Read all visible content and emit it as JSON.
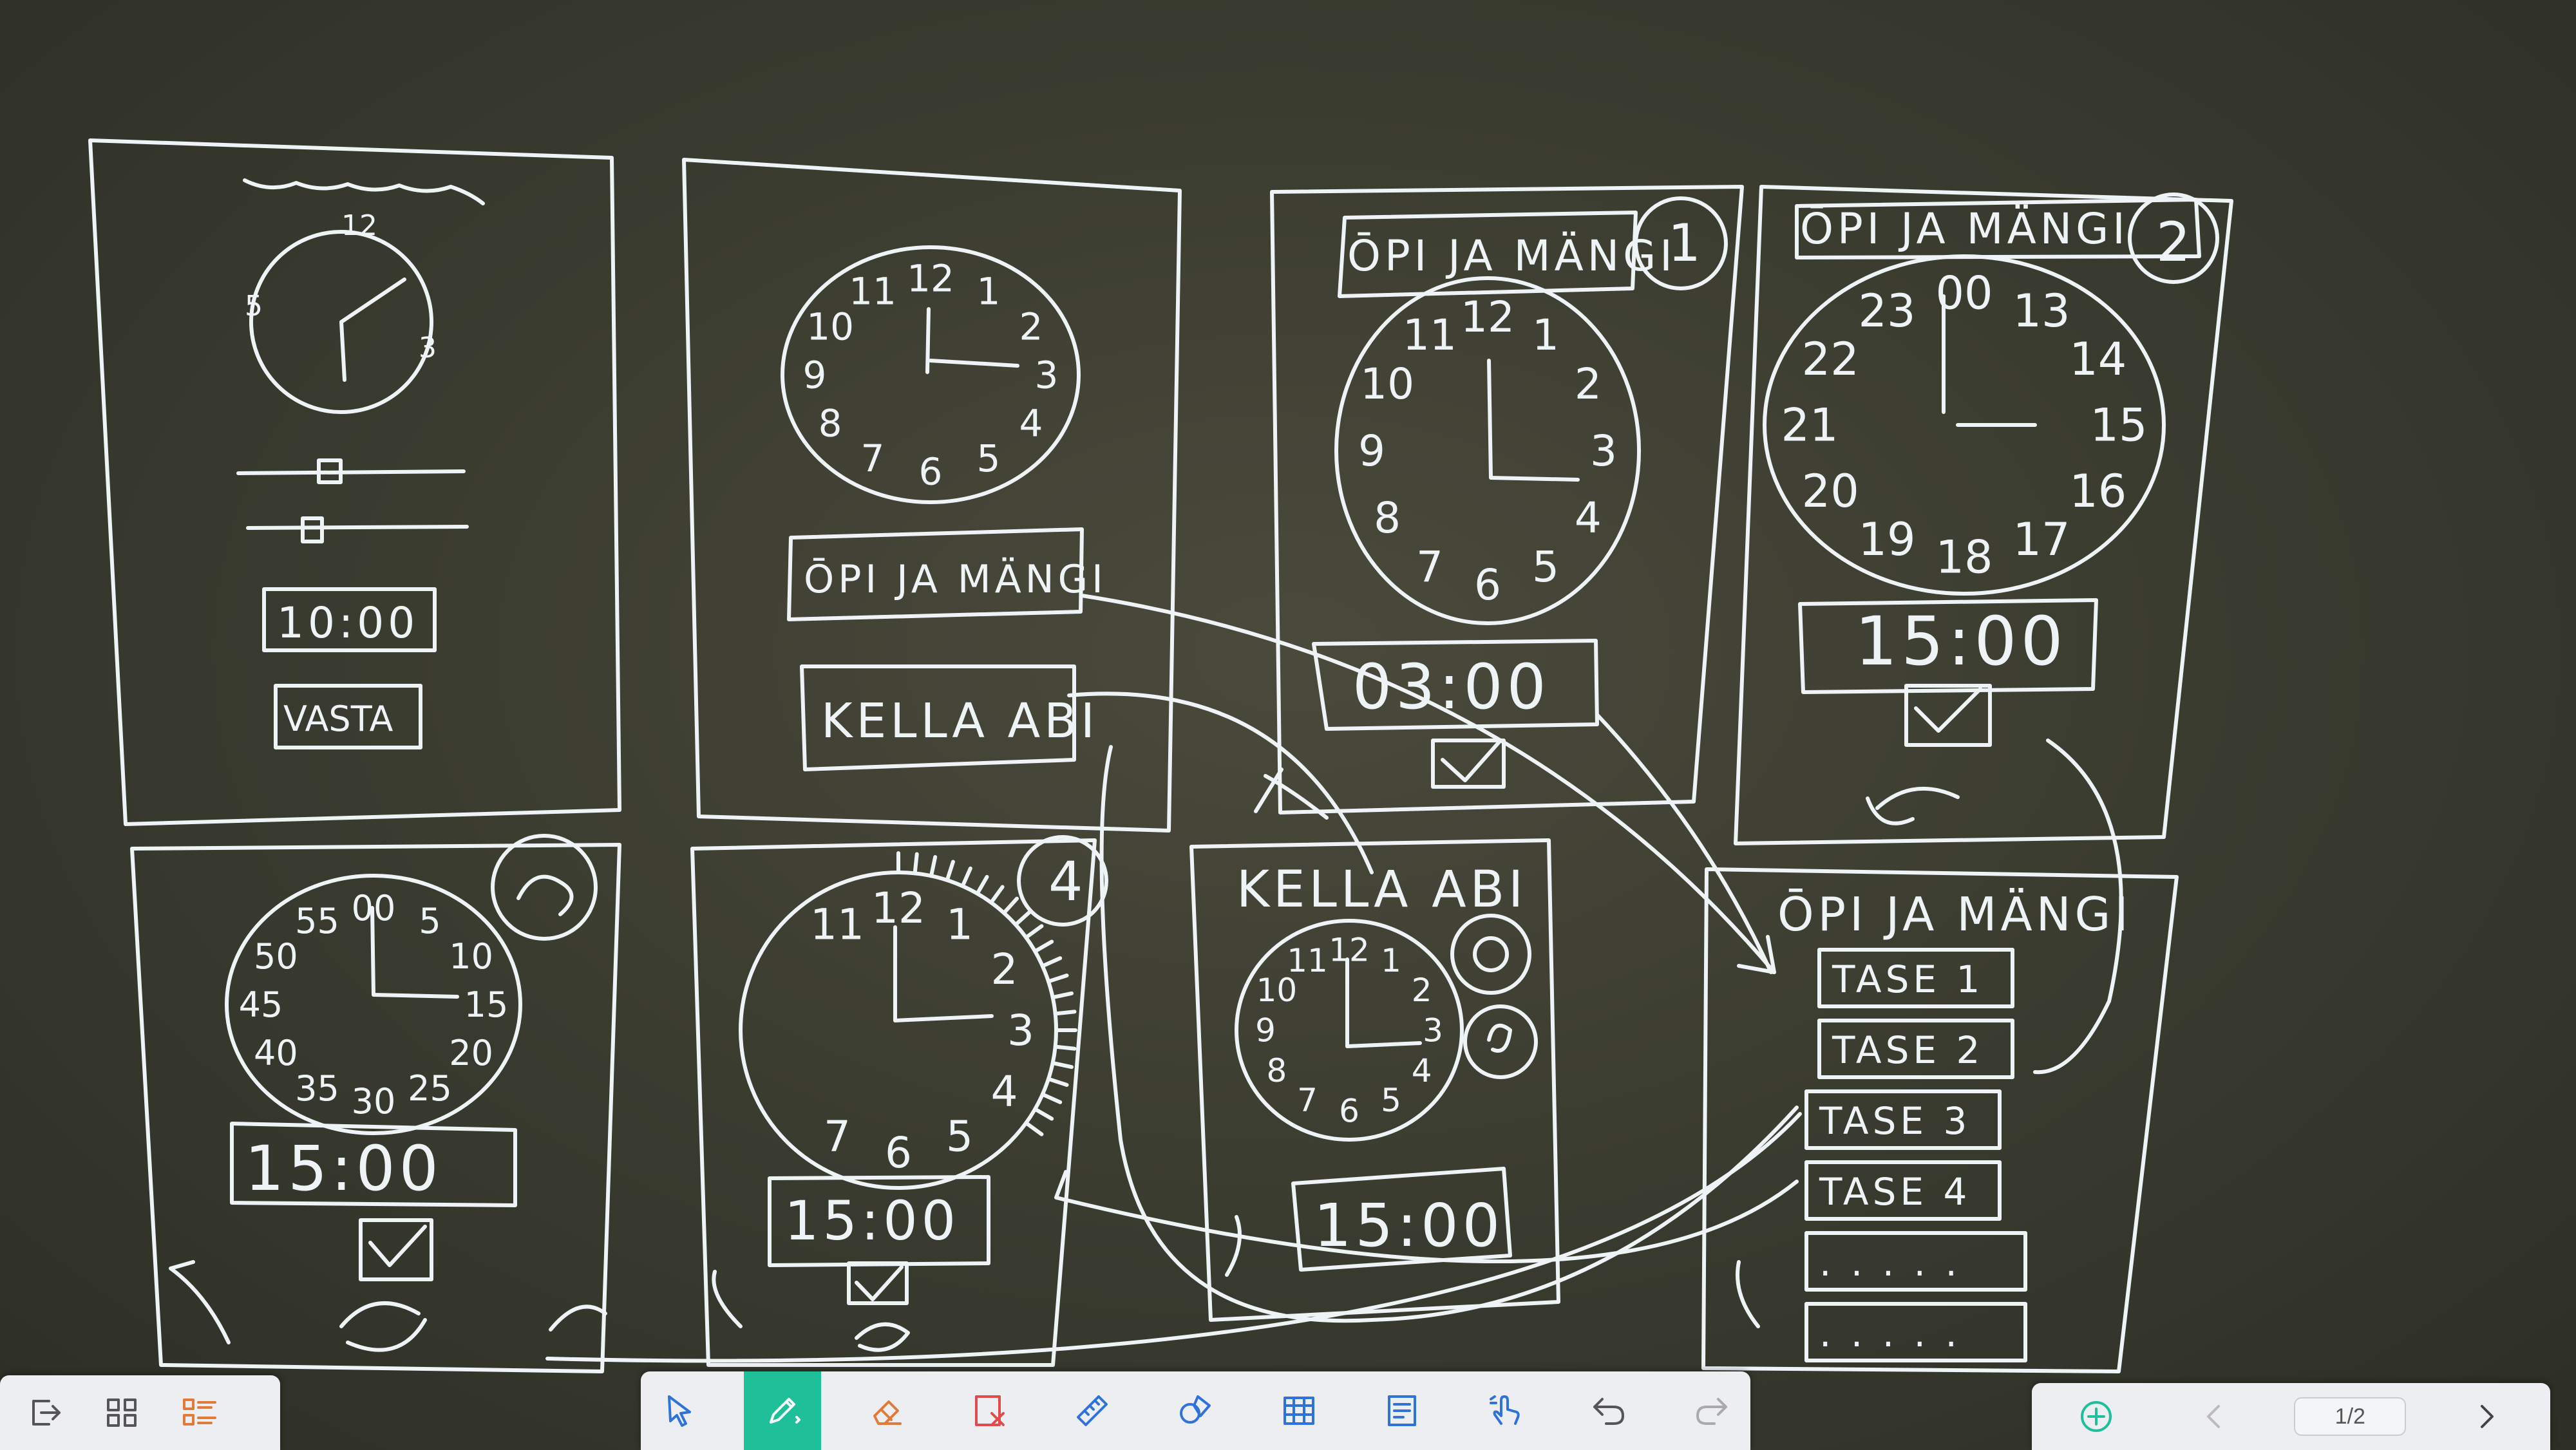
{
  "whiteboard": {
    "frames": [
      {
        "id": 1,
        "time": "10:00",
        "button": "VASTA"
      },
      {
        "id": 2,
        "title": "ŌPI JA MÄNGI",
        "button": "KELLA ABI"
      },
      {
        "id": 3,
        "title": "ŌPI JA MÄNGI",
        "badge": "1",
        "time": "03:00"
      },
      {
        "id": 4,
        "title": "ŌPI JA MÄNGI",
        "badge": "2",
        "time": "15:00"
      },
      {
        "id": 5,
        "time": "15:00"
      },
      {
        "id": 6,
        "badge": "4",
        "time": "15:00"
      },
      {
        "id": 7,
        "title": "KELLA ABI",
        "time": "15:00"
      },
      {
        "id": 8,
        "title": "ŌPI JA MÄNGI",
        "levels": [
          "TASE 1",
          "TASE 2",
          "TASE 3",
          "TASE 4",
          ". . . . .",
          ". . . . ."
        ]
      }
    ],
    "clock_numbers": {
      "frame2": [
        "12",
        "1",
        "2",
        "3",
        "4",
        "5",
        "6",
        "7",
        "8",
        "9",
        "10",
        "11"
      ],
      "frame3": [
        "12",
        "1",
        "2",
        "3",
        "4",
        "5",
        "6",
        "7",
        "8",
        "9",
        "10",
        "11"
      ],
      "frame4": [
        "00",
        "13",
        "14",
        "15",
        "16",
        "17",
        "18",
        "19",
        "20",
        "21",
        "22",
        "23"
      ],
      "frame5": [
        "00",
        "5",
        "10",
        "15",
        "20",
        "25",
        "30",
        "35",
        "40",
        "45",
        "50",
        "55"
      ],
      "frame6": [
        "12",
        "1",
        "2",
        "3",
        "4",
        "5",
        "6",
        "7",
        "11"
      ],
      "frame7": [
        "12",
        "1",
        "2",
        "3",
        "4",
        "5",
        "6",
        "7",
        "8",
        "9",
        "10",
        "11"
      ]
    }
  },
  "toolbar": {
    "left": [
      {
        "icon": "exit-icon"
      },
      {
        "icon": "grid-view-icon"
      },
      {
        "icon": "list-view-icon"
      }
    ],
    "center": [
      {
        "icon": "select-icon"
      },
      {
        "icon": "pen-icon",
        "active": true
      },
      {
        "icon": "eraser-icon"
      },
      {
        "icon": "clear-icon"
      },
      {
        "icon": "ruler-icon"
      },
      {
        "icon": "shapes-icon"
      },
      {
        "icon": "table-icon"
      },
      {
        "icon": "notes-icon"
      },
      {
        "icon": "touch-icon"
      },
      {
        "icon": "undo-icon"
      },
      {
        "icon": "redo-icon"
      }
    ],
    "right": {
      "add_icon": "add-page-icon",
      "page_indicator": "1/2"
    }
  },
  "colors": {
    "board": "#3c3d31",
    "ink": "#eef4f6",
    "toolbar": "#eceef2",
    "accent": "#1fbf9a",
    "icon": "#2f73d9"
  }
}
